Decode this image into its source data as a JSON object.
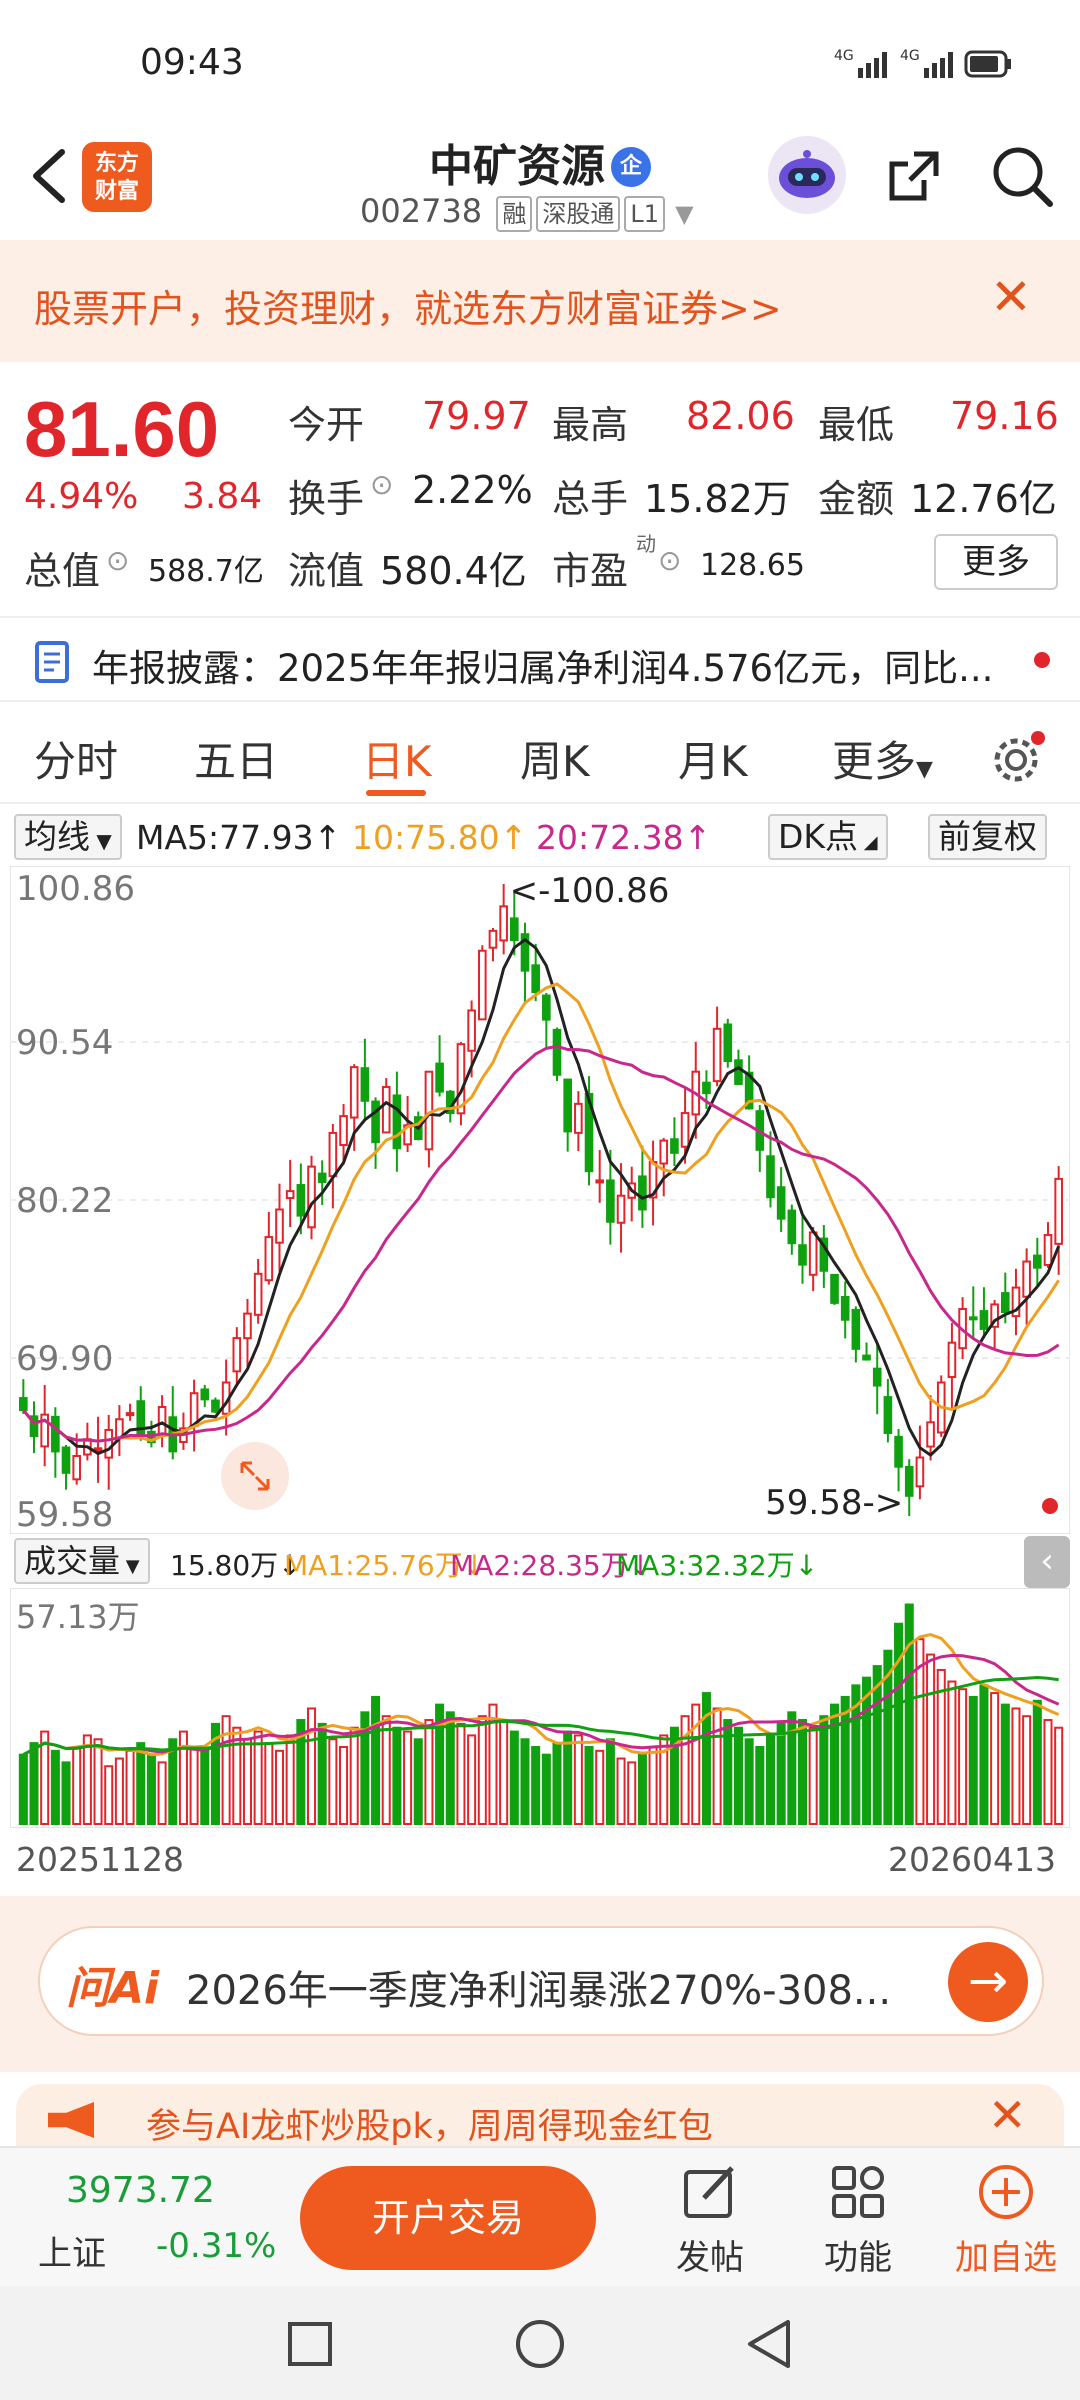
{
  "status": {
    "time": "09:43",
    "net1": "4G",
    "net2": "4G"
  },
  "header": {
    "logo_line1": "东方",
    "logo_line2": "财富",
    "stock_name": "中矿资源",
    "badge": "企",
    "code": "002738",
    "tag1": "融",
    "tag2": "深股通",
    "tag3": "L1"
  },
  "promo": {
    "text": "股票开户，投资理财，就选东方财富证券>>",
    "close": "✕"
  },
  "quote": {
    "price": "81.60",
    "pct": "4.94%",
    "change": "3.84",
    "open_label": "今开",
    "open": "79.97",
    "high_label": "最高",
    "high": "82.06",
    "low_label": "最低",
    "low": "79.16",
    "turnover_label": "换手",
    "turnover": "2.22%",
    "volume_label": "总手",
    "volume": "15.82万",
    "amount_label": "金额",
    "amount": "12.76亿",
    "mktcap_label": "总值",
    "mktcap": "588.7亿",
    "float_label": "流值",
    "float": "580.4亿",
    "pe_label": "市盈",
    "pe_sup": "动",
    "pe": "128.65",
    "more": "更多"
  },
  "notice": {
    "label": "年报披露：",
    "text": "2025年年报归属净利润4.576亿元，同比..."
  },
  "tabs": {
    "t1": "分时",
    "t2": "五日",
    "t3": "日K",
    "t4": "周K",
    "t5": "月K",
    "t6": "更多",
    "active": "日K"
  },
  "ma": {
    "selector": "均线",
    "ma5": "MA5:77.93↑",
    "ma10": "10:75.80↑",
    "ma20": "20:72.38↑",
    "dk": "DK点",
    "adj": "前复权"
  },
  "colors": {
    "up": "#e0262a",
    "down": "#0fa10f",
    "ma5": "#222222",
    "ma10": "#f0a020",
    "ma20": "#c8288c",
    "accent": "#ef5a1f"
  },
  "chart_data": {
    "type": "candlestick",
    "y_ticks": [
      "100.86",
      "90.54",
      "80.22",
      "69.90",
      "59.58"
    ],
    "ylim": [
      59.58,
      100.86
    ],
    "high_marker": "<-100.86",
    "low_marker": "59.58->",
    "closes": [
      66.5,
      64.8,
      66.2,
      63.8,
      62.4,
      63.5,
      64.6,
      64.0,
      65.2,
      65.9,
      66.3,
      65.0,
      64.4,
      66.7,
      63.8,
      65.3,
      67.6,
      67.2,
      66.4,
      68.3,
      71.2,
      72.8,
      75.4,
      77.8,
      79.6,
      80.8,
      79.2,
      82.4,
      81.4,
      84.6,
      85.7,
      88.9,
      86.7,
      84.0,
      87.6,
      83.6,
      85.1,
      84.2,
      88.6,
      87.3,
      85.9,
      90.4,
      92.6,
      96.5,
      97.8,
      99.4,
      97.2,
      95.2,
      93.8,
      92.0,
      88.4,
      84.7,
      86.5,
      82.1,
      81.5,
      78.8,
      80.5,
      81.3,
      79.6,
      82.7,
      84.1,
      83.3,
      85.9,
      88.6,
      87.2,
      91.4,
      89.3,
      87.8,
      86.2,
      83.5,
      80.4,
      79.0,
      77.4,
      76.0,
      78.1,
      75.6,
      73.5,
      72.4,
      70.5,
      69.8,
      68.1,
      65.0,
      62.8,
      60.9,
      63.4,
      65.7,
      68.3,
      70.9,
      73.1,
      72.5,
      71.8,
      73.4,
      72.9,
      74.5,
      76.2,
      75.8,
      77.93,
      81.6
    ],
    "ma": [
      {
        "name": "MA5",
        "value": 77.93
      },
      {
        "name": "MA10",
        "value": 75.8
      },
      {
        "name": "MA20",
        "value": 72.38
      }
    ]
  },
  "volume": {
    "selector": "成交量",
    "val": "15.80万↓",
    "ma1": "MA1:25.76万↓",
    "ma2": "MA2:28.35万↓",
    "ma3": "MA3:32.32万↓",
    "top": "57.13万"
  },
  "volume_data": [
    18,
    21,
    24,
    19,
    16,
    20,
    23,
    22,
    15,
    17,
    19,
    21,
    18,
    16,
    22,
    24,
    20,
    19,
    26,
    28,
    25,
    22,
    24,
    21,
    19,
    23,
    27,
    30,
    26,
    22,
    20,
    25,
    29,
    33,
    28,
    25,
    24,
    22,
    27,
    31,
    29,
    26,
    23,
    28,
    31,
    27,
    24,
    22,
    20,
    18,
    21,
    24,
    23,
    20,
    19,
    22,
    17,
    16,
    18,
    20,
    23,
    25,
    28,
    31,
    34,
    30,
    27,
    25,
    22,
    20,
    23,
    26,
    29,
    27,
    25,
    28,
    31,
    33,
    36,
    38,
    41,
    45,
    52,
    57,
    48,
    44,
    40,
    37,
    35,
    33,
    36,
    34,
    31,
    30,
    28,
    32,
    27,
    25
  ],
  "dates": {
    "start": "20251128",
    "end": "20260413"
  },
  "ai": {
    "brand": "问Ai",
    "text": "2026年一季度净利润暴涨270%-308...",
    "go": "→"
  },
  "promo2": {
    "text": "参与AI龙虾炒股pk，周周得现金红包",
    "close": "✕"
  },
  "bottom": {
    "index_value": "3973.72",
    "index_name": "上证",
    "index_change": "-0.31%",
    "trade": "开户交易",
    "post": "发帖",
    "func": "功能",
    "add": "加自选"
  }
}
